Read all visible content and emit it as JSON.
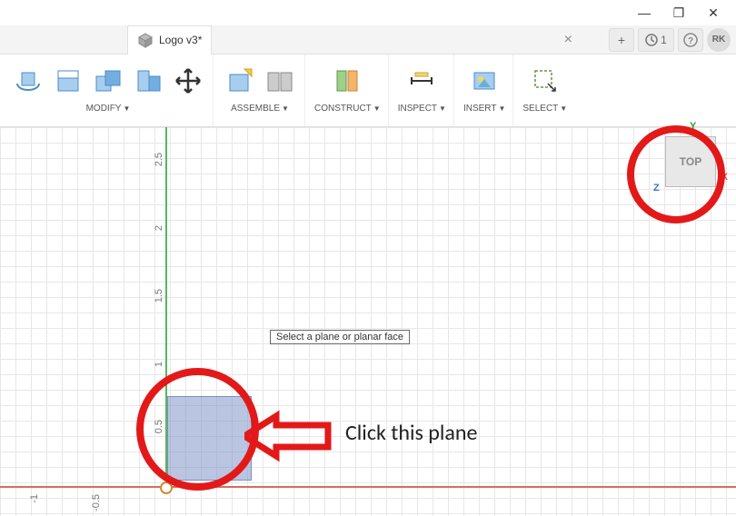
{
  "window": {
    "minimize": "—",
    "maximize": "❐",
    "close": "✕"
  },
  "tab": {
    "title": "Logo v3*",
    "close_x": "×"
  },
  "tabbar": {
    "plus": "+",
    "job_count": "1",
    "help": "?",
    "user_initials": "RK"
  },
  "toolbar": {
    "modify": "MODIFY",
    "assemble": "ASSEMBLE",
    "construct": "CONSTRUCT",
    "inspect": "INSPECT",
    "insert": "INSERT",
    "select": "SELECT"
  },
  "viewcube": {
    "face": "TOP",
    "y": "Y",
    "x": "X",
    "z": "Z"
  },
  "hint": "Select a plane or planar face",
  "annotation": "Click this plane",
  "ticks_y": [
    "2.5",
    "2",
    "1.5",
    "1",
    "0.5"
  ],
  "ticks_x": [
    "-1",
    "-0.5"
  ]
}
